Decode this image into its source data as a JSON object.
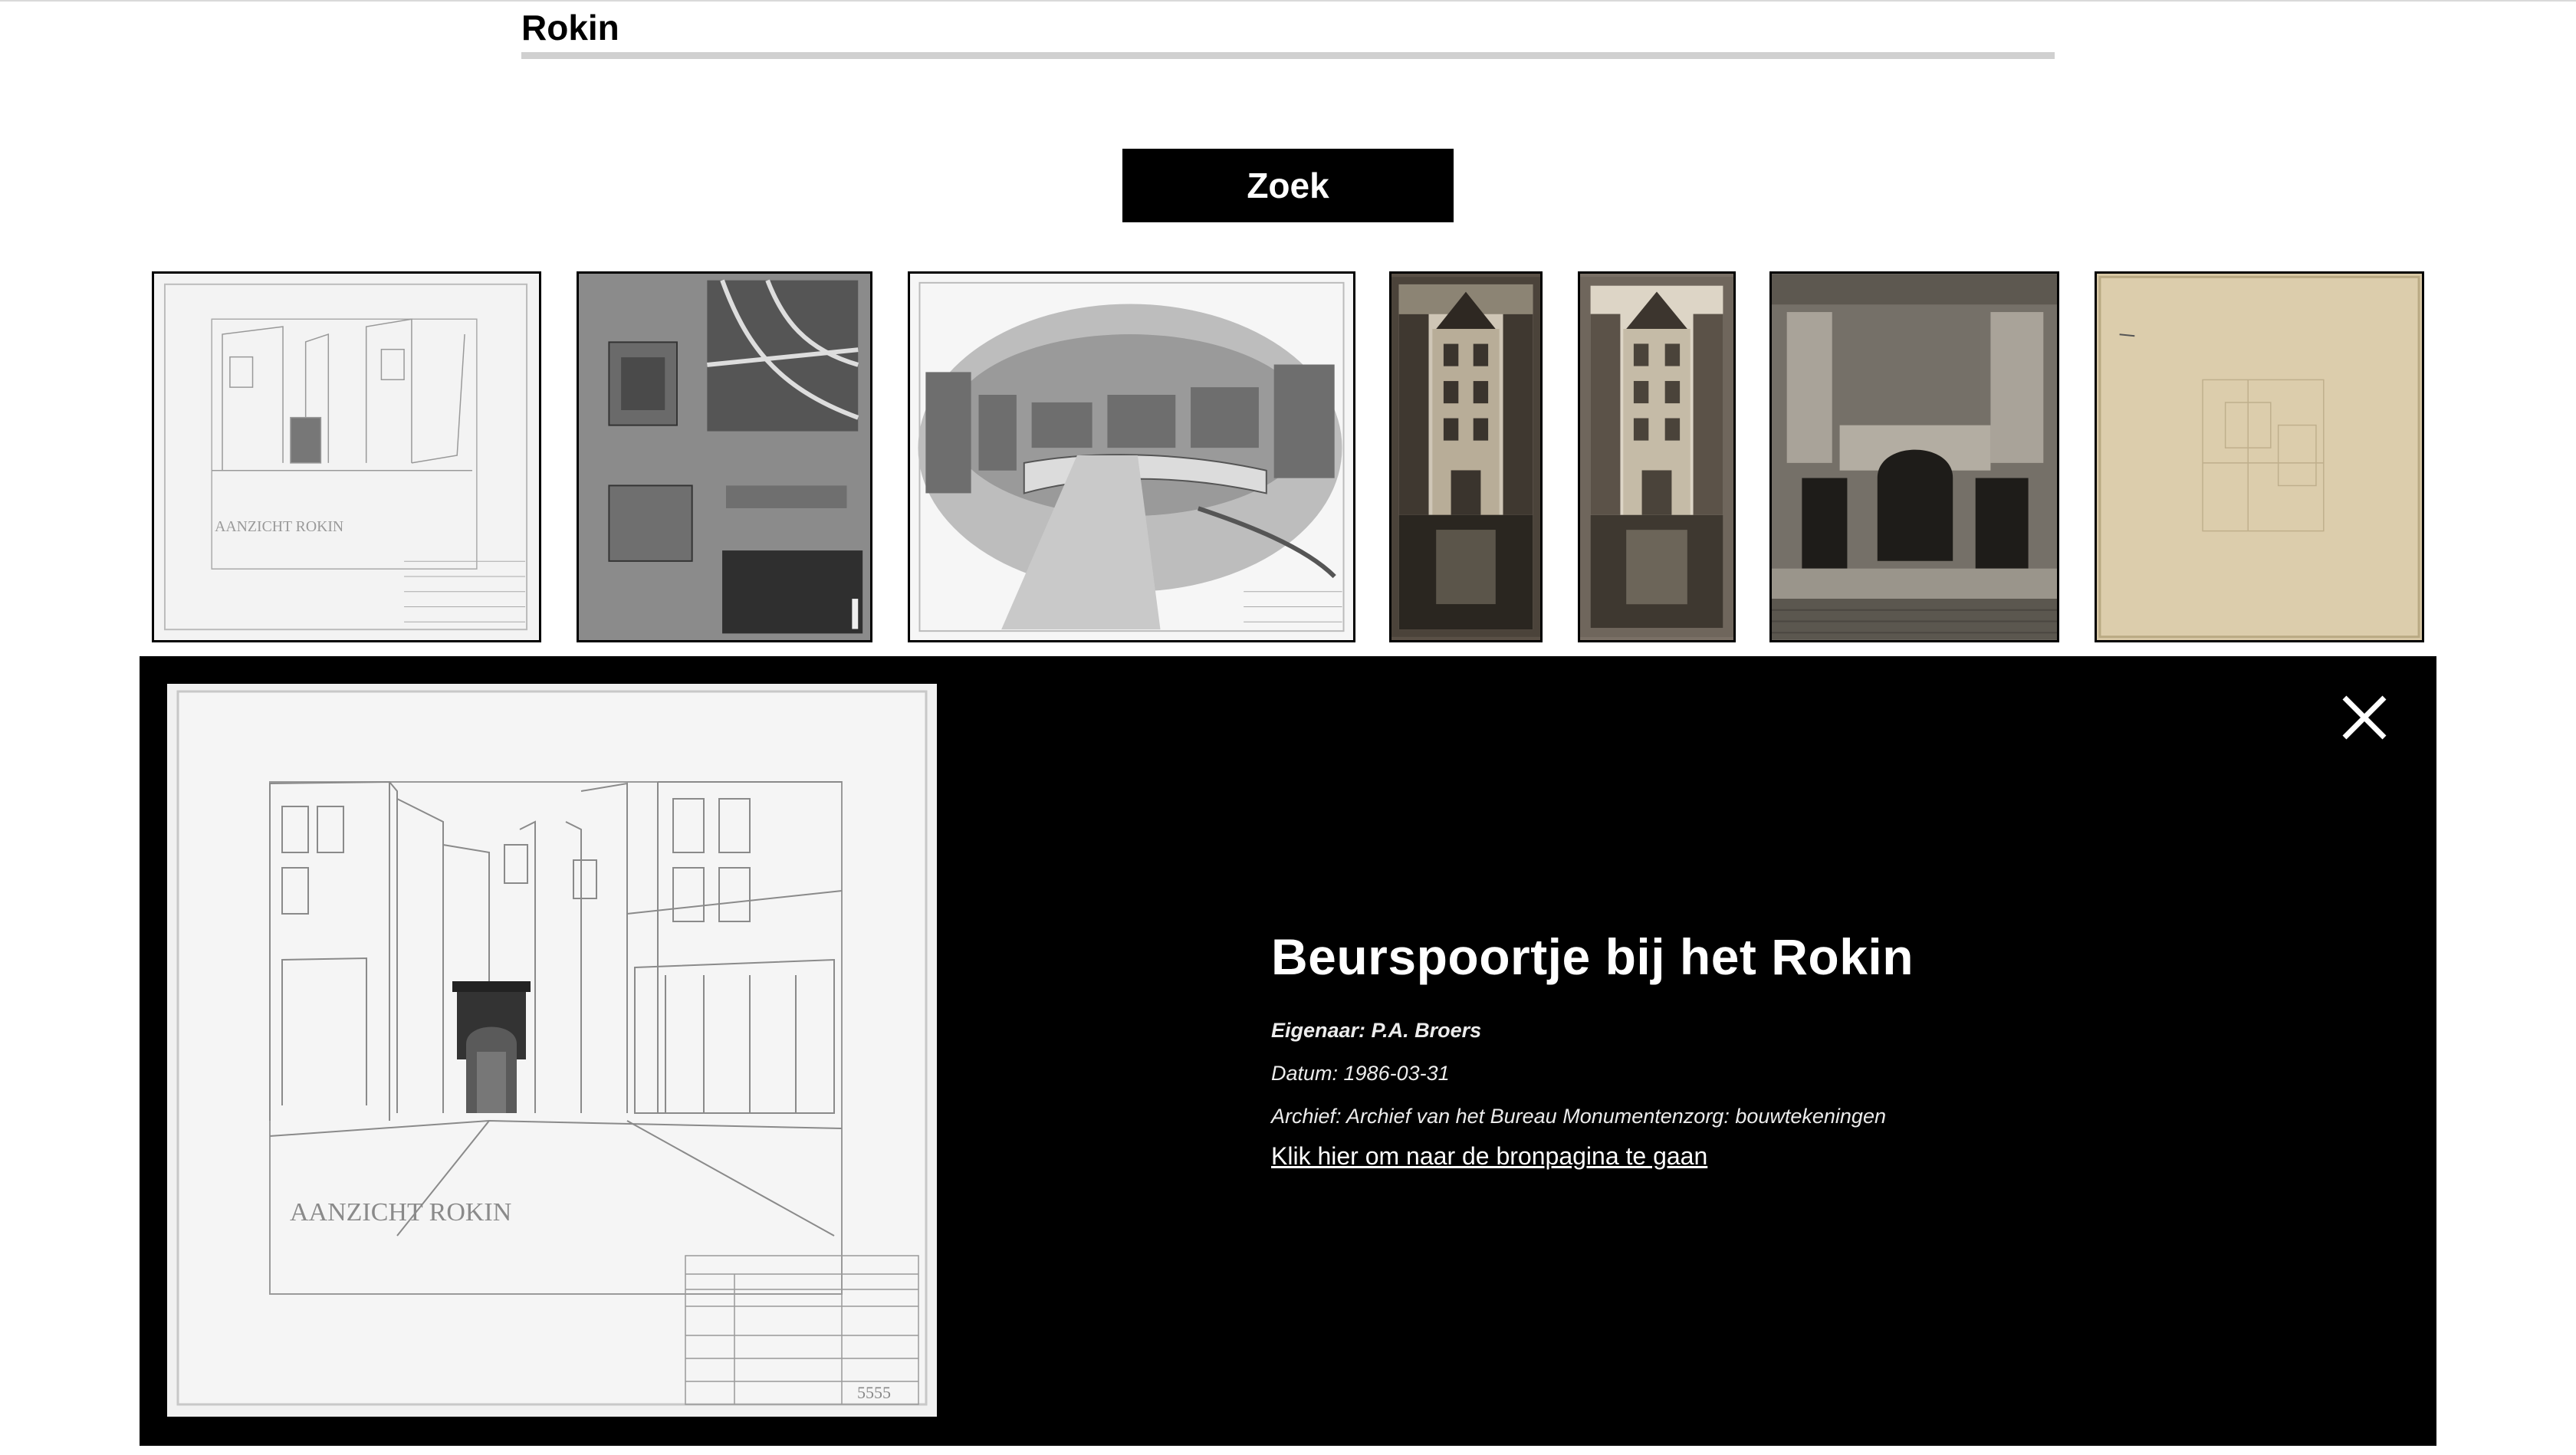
{
  "search": {
    "value": "Rokin",
    "button_label": "Zoek"
  },
  "thumbnails": [
    {
      "description": "bouwtekening aanzicht Rokin",
      "tone": "#f0f0f0"
    },
    {
      "description": "bouwtekening met plattegrond",
      "tone": "#8a8a8a"
    },
    {
      "description": "tekening Rokin met brug",
      "tone": "#e8e8e8"
    },
    {
      "description": "foto gebouw aan gracht",
      "tone": "#5a5046"
    },
    {
      "description": "foto gebouw aan gracht",
      "tone": "#7a7066"
    },
    {
      "description": "foto entree gebouw",
      "tone": "#6a665e"
    },
    {
      "description": "plattegrond op perkament",
      "tone": "#d6c7a4"
    }
  ],
  "detail": {
    "title": "Beurspoortje bij het Rokin",
    "owner": "Eigenaar: P.A. Broers",
    "date": "Datum: 1986-03-31",
    "archive": "Archief: Archief van het Bureau Monumentenzorg: bouwtekeningen",
    "link_text": "Klik hier om naar de bronpagina te gaan",
    "drawing_caption": "AANZICHT ROKIN",
    "drawing_number": "5555"
  },
  "icons": {
    "close": "close-icon"
  },
  "colors": {
    "panel_bg": "#000000",
    "button_bg": "#000000",
    "underline": "#d0d0d0"
  }
}
